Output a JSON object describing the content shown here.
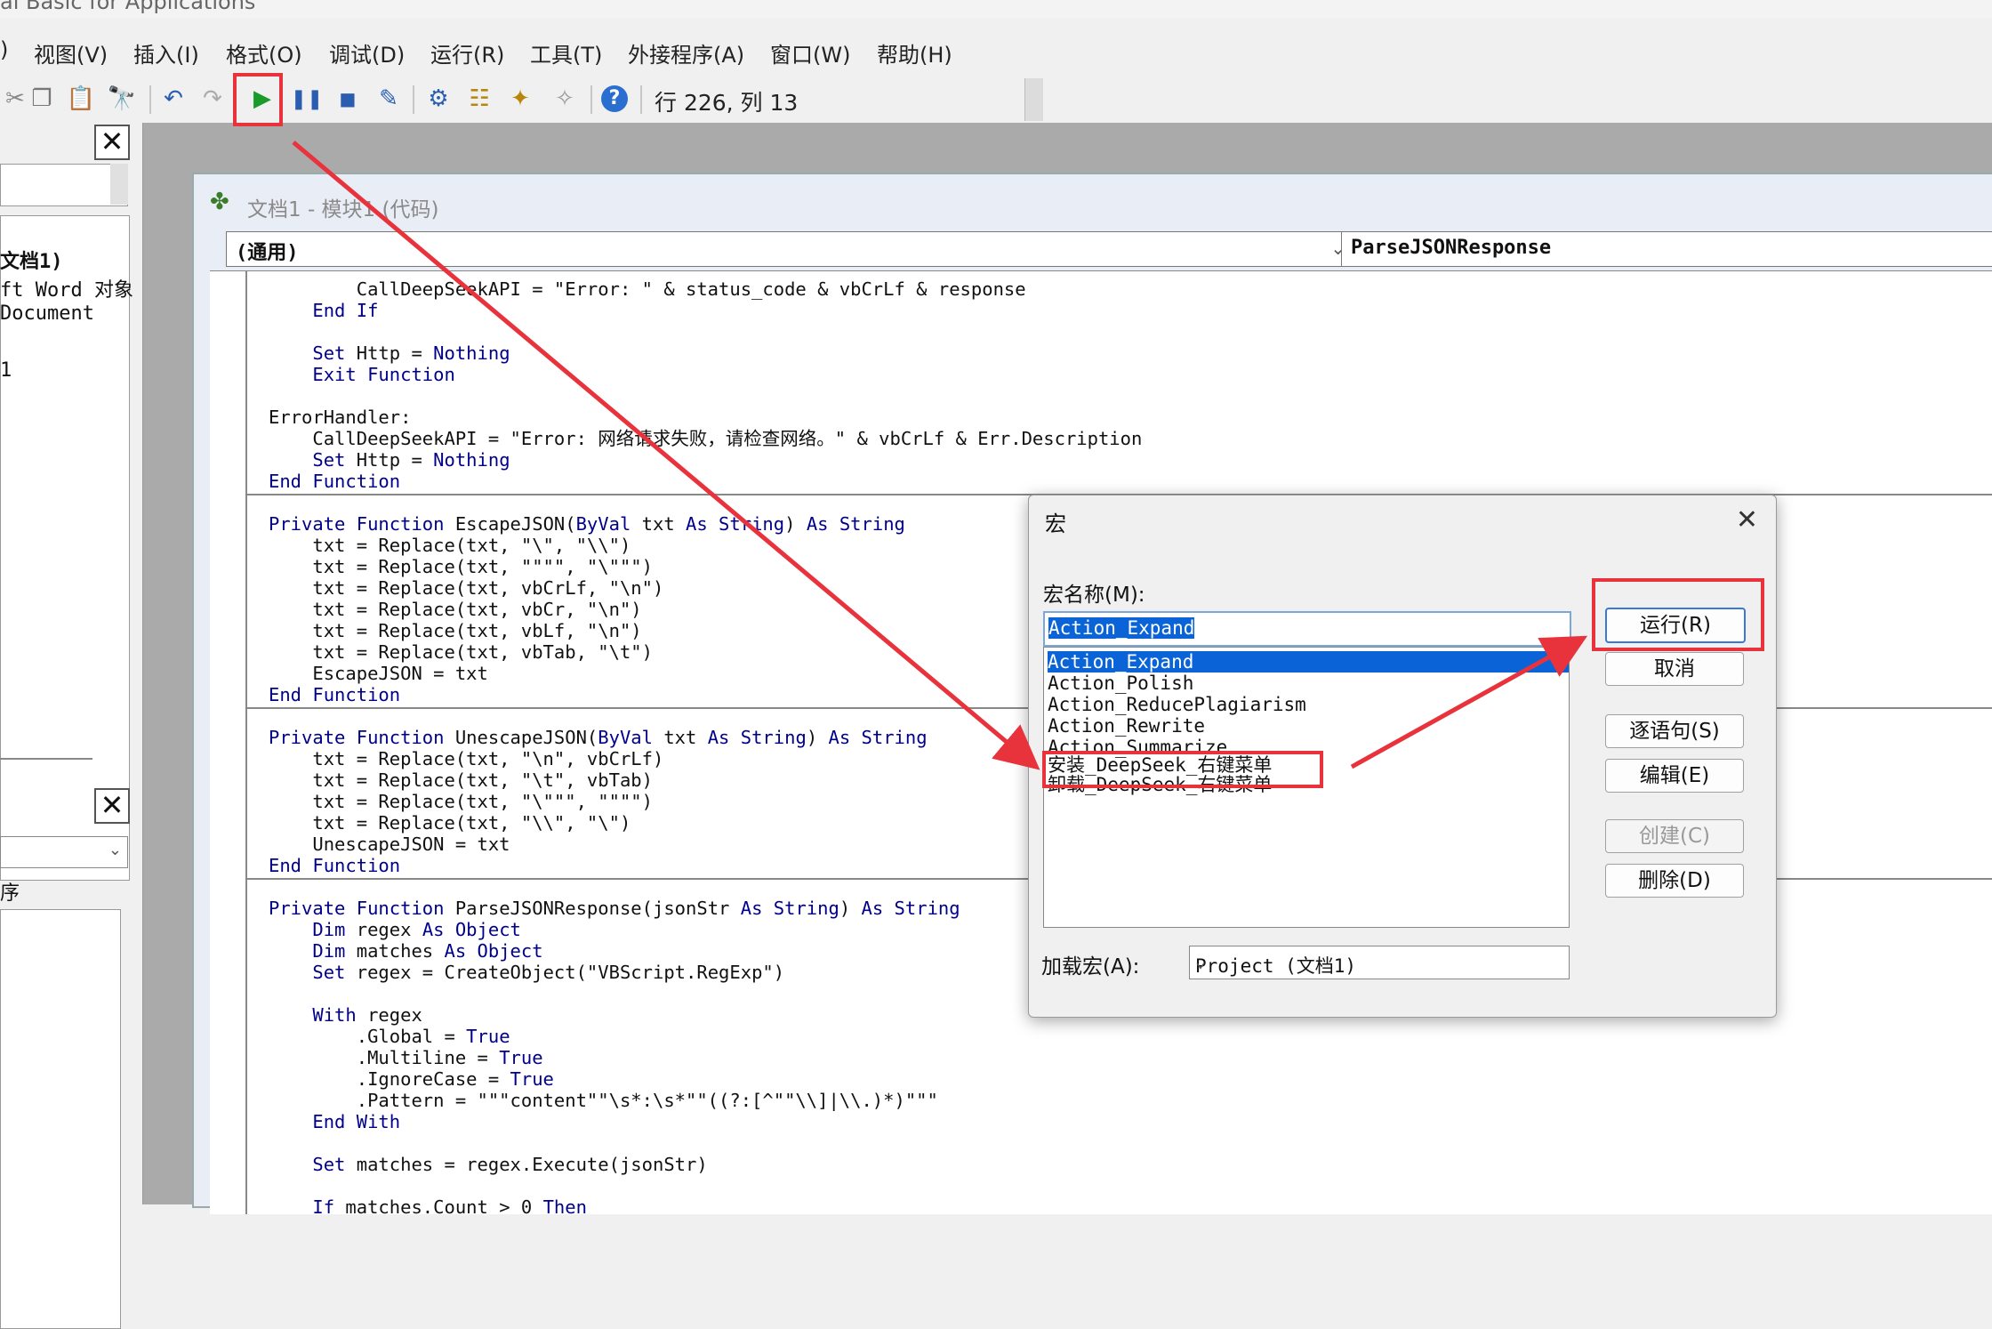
{
  "window_title": "al Basic for Applications",
  "menu": [
    ")",
    "视图(V)",
    "插入(I)",
    "格式(O)",
    "调试(D)",
    "运行(R)",
    "工具(T)",
    "外接程序(A)",
    "窗口(W)",
    "帮助(H)"
  ],
  "toolbar": {
    "position": "行 226, 列 13",
    "icons": [
      "cut-icon",
      "copy-icon",
      "paste-icon",
      "find-icon",
      "undo-icon",
      "redo-icon",
      "run-icon",
      "pause-icon",
      "stop-icon",
      "design-mode-icon",
      "project-explorer-icon",
      "properties-icon",
      "object-browser-icon",
      "toolbox-icon",
      "help-icon"
    ]
  },
  "left_panel": {
    "project_lines": [
      "文档1)",
      "ft Word 对象",
      "Document",
      "1"
    ],
    "props_label": "序"
  },
  "code_window": {
    "title": "文档1 - 模块1 (代码)",
    "object_combo": "(通用)",
    "proc_combo": "ParseJSONResponse",
    "lines": [
      "        CallDeepSeekAPI = \"Error: \" & status_code & vbCrLf & response",
      "    End If",
      "",
      "    Set Http = Nothing",
      "    Exit Function",
      "",
      "ErrorHandler:",
      "    CallDeepSeekAPI = \"Error: 网络请求失败，请检查网络。\" & vbCrLf & Err.Description",
      "    Set Http = Nothing",
      "End Function",
      "",
      "Private Function EscapeJSON(ByVal txt As String) As String",
      "    txt = Replace(txt, \"\\\", \"\\\\\")",
      "    txt = Replace(txt, \"\"\"\", \"\\\"\"\")",
      "    txt = Replace(txt, vbCrLf, \"\\n\")",
      "    txt = Replace(txt, vbCr, \"\\n\")",
      "    txt = Replace(txt, vbLf, \"\\n\")",
      "    txt = Replace(txt, vbTab, \"\\t\")",
      "    EscapeJSON = txt",
      "End Function",
      "",
      "Private Function UnescapeJSON(ByVal txt As String) As String",
      "    txt = Replace(txt, \"\\n\", vbCrLf)",
      "    txt = Replace(txt, \"\\t\", vbTab)",
      "    txt = Replace(txt, \"\\\"\"\", \"\"\"\")",
      "    txt = Replace(txt, \"\\\\\", \"\\\")",
      "    UnescapeJSON = txt",
      "End Function",
      "",
      "Private Function ParseJSONResponse(jsonStr As String) As String",
      "    Dim regex As Object",
      "    Dim matches As Object",
      "    Set regex = CreateObject(\"VBScript.RegExp\")",
      "",
      "    With regex",
      "        .Global = True",
      "        .Multiline = True",
      "        .IgnoreCase = True",
      "        .Pattern = \"\"\"content\"\"\\s*:\\s*\"\"((?:[^\"\"\\\\]|\\\\.)*)\"\"\"",
      "    End With",
      "",
      "    Set matches = regex.Execute(jsonStr)",
      "",
      "    If matches.Count > 0 Then"
    ]
  },
  "macro_dialog": {
    "title": "宏",
    "name_label": "宏名称(M):",
    "name_value": "Action_Expand",
    "list": [
      "Action_Expand",
      "Action_Polish",
      "Action_ReducePlagiarism",
      "Action_Rewrite",
      "Action_Summarize",
      "安装_DeepSeek_右键菜单",
      "卸载_DeepSeek_右键菜单"
    ],
    "buttons": {
      "run": "运行(R)",
      "cancel": "取消",
      "step": "逐语句(S)",
      "edit": "编辑(E)",
      "create": "创建(C)",
      "delete": "删除(D)"
    },
    "load_label": "加载宏(A):",
    "load_value": "Project (文档1)"
  },
  "colors": {
    "annotation": "#e8323c",
    "keyword": "#00008b",
    "selection": "#0a64d8"
  }
}
